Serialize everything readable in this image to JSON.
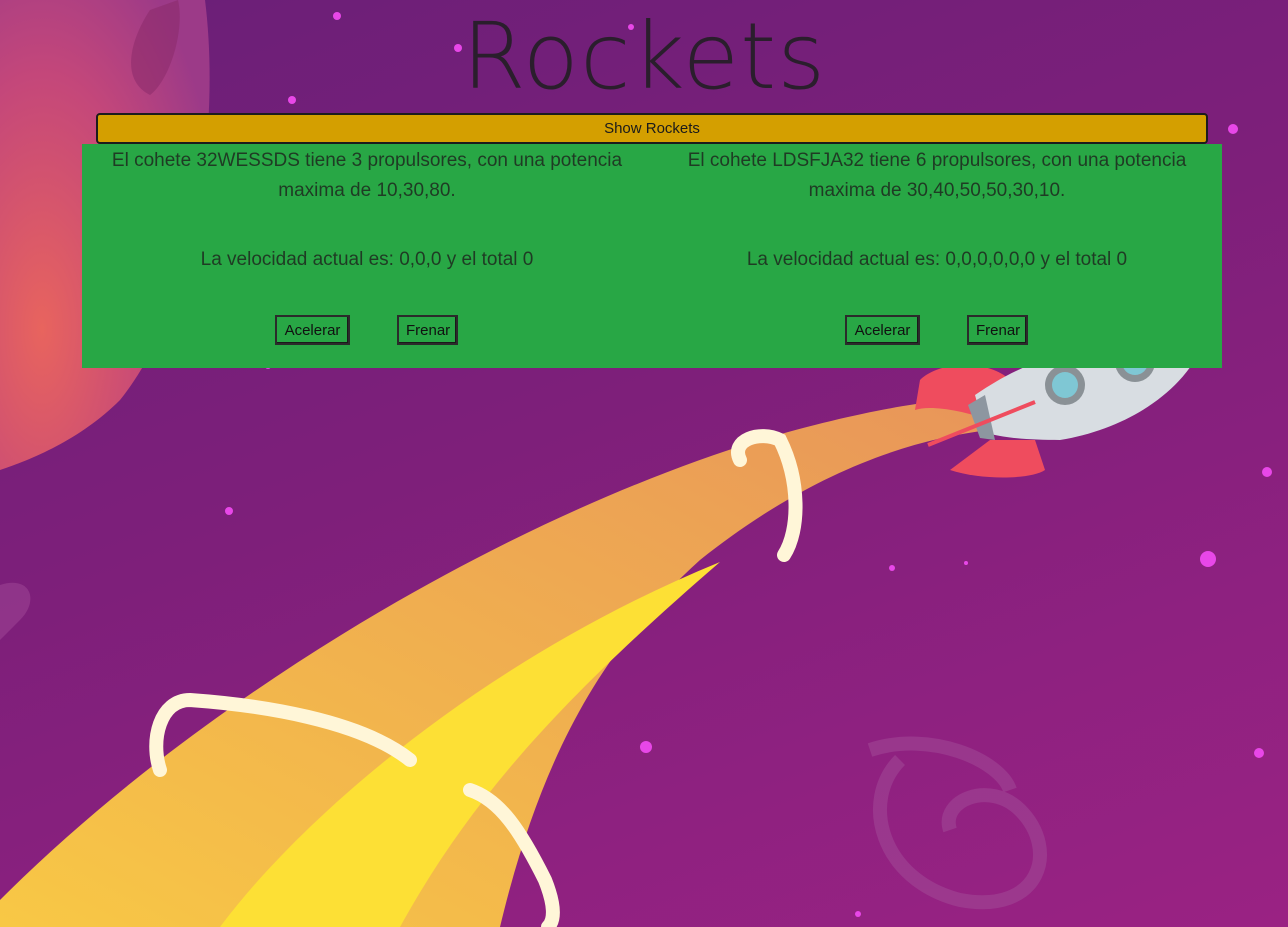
{
  "header": {
    "title": "Rockets"
  },
  "toolbar": {
    "show_label": "Show Rockets"
  },
  "rockets": [
    {
      "description": "El cohete 32WESSDS tiene 3 propulsores, con una potencia maxima de 10,30,80.",
      "speed": "La velocidad actual es: 0,0,0 y el total 0",
      "accelerate_label": "Acelerar",
      "brake_label": "Frenar"
    },
    {
      "description": "El cohete LDSFJA32 tiene 6 propulsores, con una potencia maxima de 30,40,50,50,30,10.",
      "speed": "La velocidad actual es: 0,0,0,0,0,0 y el total 0",
      "accelerate_label": "Acelerar",
      "brake_label": "Frenar"
    }
  ],
  "colors": {
    "background": "#7e1f7a",
    "show_button": "#d49f00",
    "panel": "#28a745",
    "flame": "#f0b347",
    "rocket_fin": "#ef4c5e"
  }
}
